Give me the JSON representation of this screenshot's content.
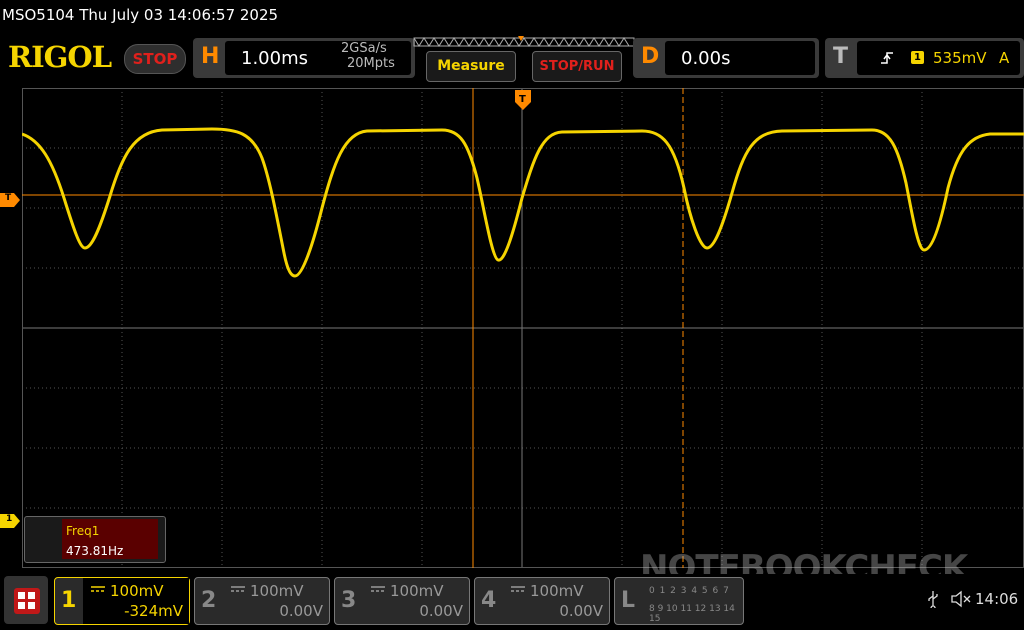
{
  "header": {
    "title": "MSO5104  Thu July 03 14:06:57 2025"
  },
  "brand": {
    "logo": "RIGOL",
    "run_state": "STOP"
  },
  "horizontal": {
    "letter": "H",
    "timebase": "1.00ms",
    "sample_rate": "2GSa/s",
    "memory_depth": "20Mpts"
  },
  "buttons": {
    "measure": "Measure",
    "stop_run": "STOP/RUN"
  },
  "delay": {
    "letter": "D",
    "value": "0.00s"
  },
  "trigger": {
    "letter": "T",
    "source": "1",
    "level": "535mV",
    "mode": "A",
    "marker": "T"
  },
  "measurement": {
    "label": "Freq1",
    "value": "473.81Hz"
  },
  "channels": [
    {
      "num": "1",
      "scale": "100mV",
      "offset": "-324mV",
      "marker": "1"
    },
    {
      "num": "2",
      "scale": "100mV",
      "offset": "0.00V"
    },
    {
      "num": "3",
      "scale": "100mV",
      "offset": "0.00V"
    },
    {
      "num": "4",
      "scale": "100mV",
      "offset": "0.00V"
    }
  ],
  "logic": {
    "letter": "L",
    "row1": "0 1 2 3 4 5 6 7",
    "row2": "8 9 10 11 12 13 14 15"
  },
  "status": {
    "time": "14:06"
  },
  "watermark": "NOTEBOOKCHECK",
  "colors": {
    "ch1": "#f5d400",
    "trigger": "#ff8a00",
    "stop": "#e0201c"
  }
}
